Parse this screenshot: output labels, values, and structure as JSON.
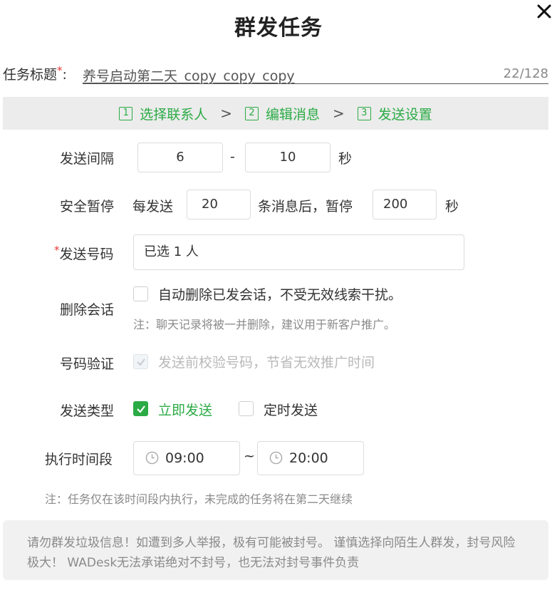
{
  "dialog": {
    "title": "群发任务"
  },
  "task_title": {
    "label": "任务标题",
    "required_mark": "*",
    "colon": ":",
    "value": "养号启动第二天_copy_copy_copy",
    "counter": "22/128"
  },
  "steps": [
    {
      "num": "1",
      "label": "选择联系人"
    },
    {
      "num": "2",
      "label": "编辑消息"
    },
    {
      "num": "3",
      "label": "发送设置"
    }
  ],
  "step_separator": ">",
  "send_interval": {
    "label": "发送间隔",
    "min": "6",
    "dash": "-",
    "max": "10",
    "unit": "秒"
  },
  "safe_pause": {
    "label": "安全暂停",
    "prefix": "每发送",
    "count": "20",
    "middle": "条消息后，暂停",
    "seconds": "200",
    "unit": "秒"
  },
  "send_number": {
    "required_mark": "*",
    "label": "发送号码",
    "value": "已选 1 人"
  },
  "delete_chat": {
    "label": "删除会话",
    "checked": false,
    "option": "自动删除已发会话，不受无效线索干扰。",
    "note": "注：聊天记录将被一并删除，建议用于新客户推广。"
  },
  "verify_number": {
    "label": "号码验证",
    "checked": true,
    "disabled": true,
    "option": "发送前校验号码，节省无效推广时间"
  },
  "send_type": {
    "label": "发送类型",
    "immediate": {
      "label": "立即发送",
      "checked": true
    },
    "scheduled": {
      "label": "定时发送",
      "checked": false
    }
  },
  "exec_period": {
    "label": "执行时间段",
    "start": "09:00",
    "tilde": "~",
    "end": "20:00",
    "note": "注：任务仅在该时间段内执行，未完成的任务将在第二天继续"
  },
  "warning": {
    "text": "请勿群发垃圾信息！如遭到多人举报，极有可能被封号。 谨慎选择向陌生人群发，封号风险极大！ WADesk无法承诺绝对不封号，也无法对封号事件负责"
  },
  "colors": {
    "accent": "#2bab45",
    "required": "#e53935",
    "muted": "#8a8a8a",
    "step_bar": "#ececec"
  }
}
